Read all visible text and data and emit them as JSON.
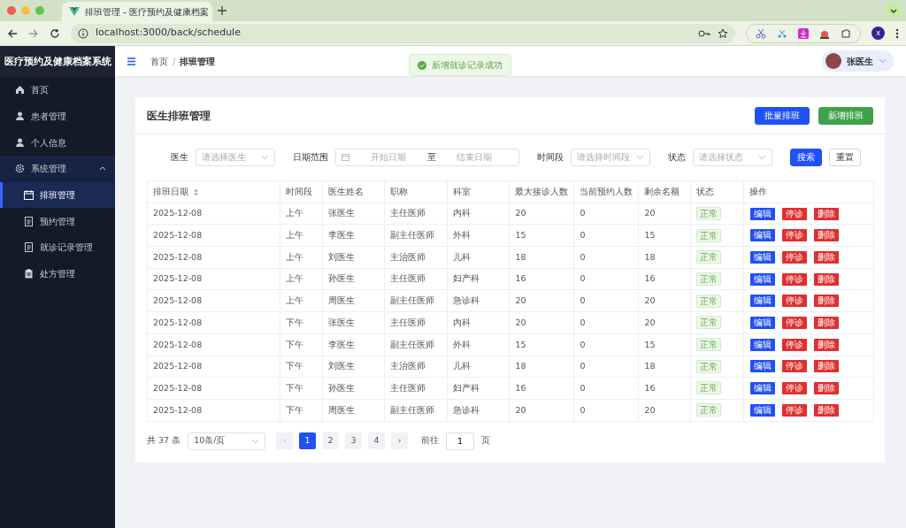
{
  "browser": {
    "tab_title": "排班管理 - 医疗预约及健康档案",
    "url": "localhost:3000/back/schedule",
    "profile_initial": "x"
  },
  "sidebar": {
    "title": "医疗预约及健康档案系统",
    "items": [
      {
        "label": "首页",
        "selected": false
      },
      {
        "label": "患者管理",
        "selected": false
      },
      {
        "label": "个人信息",
        "selected": false
      },
      {
        "label": "系统管理",
        "selected": false,
        "expanded": true,
        "children": [
          {
            "label": "排班管理",
            "selected": true
          },
          {
            "label": "预约管理",
            "selected": false
          },
          {
            "label": "就诊记录管理",
            "selected": false
          },
          {
            "label": "处方管理",
            "selected": false
          }
        ]
      }
    ]
  },
  "header": {
    "breadcrumbs": [
      "首页",
      "排班管理"
    ],
    "breadcrumb_separator": "/",
    "user_name": "张医生"
  },
  "toast": {
    "message": "新增就诊记录成功"
  },
  "page": {
    "title": "医生排班管理",
    "buttons": [
      {
        "label": "批量排班",
        "kind": "primary"
      },
      {
        "label": "新增排班",
        "kind": "success"
      }
    ],
    "filters": [
      {
        "kind": "select",
        "label": "医生",
        "placeholder": "请选择医生"
      },
      {
        "kind": "daterange",
        "label": "日期范围",
        "start_placeholder": "开始日期",
        "separator": "至",
        "end_placeholder": "结束日期"
      },
      {
        "kind": "select",
        "label": "时间段",
        "placeholder": "请选择时间段"
      },
      {
        "kind": "select",
        "label": "状态",
        "placeholder": "请选择状态"
      }
    ],
    "filter_buttons": [
      {
        "label": "搜索",
        "kind": "primary"
      },
      {
        "label": "重置",
        "kind": "default"
      }
    ],
    "table": {
      "columns": [
        "排班日期",
        "时间段",
        "医生姓名",
        "职称",
        "科室",
        "最大接诊人数",
        "当前预约人数",
        "剩余名额",
        "状态",
        "操作"
      ],
      "rows": [
        {
          "cells": [
            "2025-12-08",
            "上午",
            "张医生",
            "主任医师",
            "内科",
            "20",
            "0",
            "20",
            "正常"
          ],
          "actions": [
            "编辑",
            "停诊",
            "删除"
          ]
        },
        {
          "cells": [
            "2025-12-08",
            "上午",
            "李医生",
            "副主任医师",
            "外科",
            "15",
            "0",
            "15",
            "正常"
          ],
          "actions": [
            "编辑",
            "停诊",
            "删除"
          ]
        },
        {
          "cells": [
            "2025-12-08",
            "上午",
            "刘医生",
            "主治医师",
            "儿科",
            "18",
            "0",
            "18",
            "正常"
          ],
          "actions": [
            "编辑",
            "停诊",
            "删除"
          ]
        },
        {
          "cells": [
            "2025-12-08",
            "上午",
            "孙医生",
            "主任医师",
            "妇产科",
            "16",
            "0",
            "16",
            "正常"
          ],
          "actions": [
            "编辑",
            "停诊",
            "删除"
          ]
        },
        {
          "cells": [
            "2025-12-08",
            "上午",
            "周医生",
            "副主任医师",
            "急诊科",
            "20",
            "0",
            "20",
            "正常"
          ],
          "actions": [
            "编辑",
            "停诊",
            "删除"
          ]
        },
        {
          "cells": [
            "2025-12-08",
            "下午",
            "张医生",
            "主任医师",
            "内科",
            "20",
            "0",
            "20",
            "正常"
          ],
          "actions": [
            "编辑",
            "停诊",
            "删除"
          ]
        },
        {
          "cells": [
            "2025-12-08",
            "下午",
            "李医生",
            "副主任医师",
            "外科",
            "15",
            "0",
            "15",
            "正常"
          ],
          "actions": [
            "编辑",
            "停诊",
            "删除"
          ]
        },
        {
          "cells": [
            "2025-12-08",
            "下午",
            "刘医生",
            "主治医师",
            "儿科",
            "18",
            "0",
            "18",
            "正常"
          ],
          "actions": [
            "编辑",
            "停诊",
            "删除"
          ]
        },
        {
          "cells": [
            "2025-12-08",
            "下午",
            "孙医生",
            "主任医师",
            "妇产科",
            "16",
            "0",
            "16",
            "正常"
          ],
          "actions": [
            "编辑",
            "停诊",
            "删除"
          ]
        },
        {
          "cells": [
            "2025-12-08",
            "下午",
            "周医生",
            "副主任医师",
            "急诊科",
            "20",
            "0",
            "20",
            "正常"
          ],
          "actions": [
            "编辑",
            "停诊",
            "删除"
          ]
        }
      ]
    },
    "pagination": {
      "total": "共 37 条",
      "page_size": "10条/页",
      "prev": "‹",
      "next": "›",
      "pages": [
        {
          "label": "1",
          "selected": true
        },
        {
          "label": "2",
          "selected": false
        },
        {
          "label": "3",
          "selected": false
        },
        {
          "label": "4",
          "selected": false
        }
      ],
      "goto_label": "前往",
      "goto_value": "1",
      "goto_suffix": "页"
    }
  }
}
